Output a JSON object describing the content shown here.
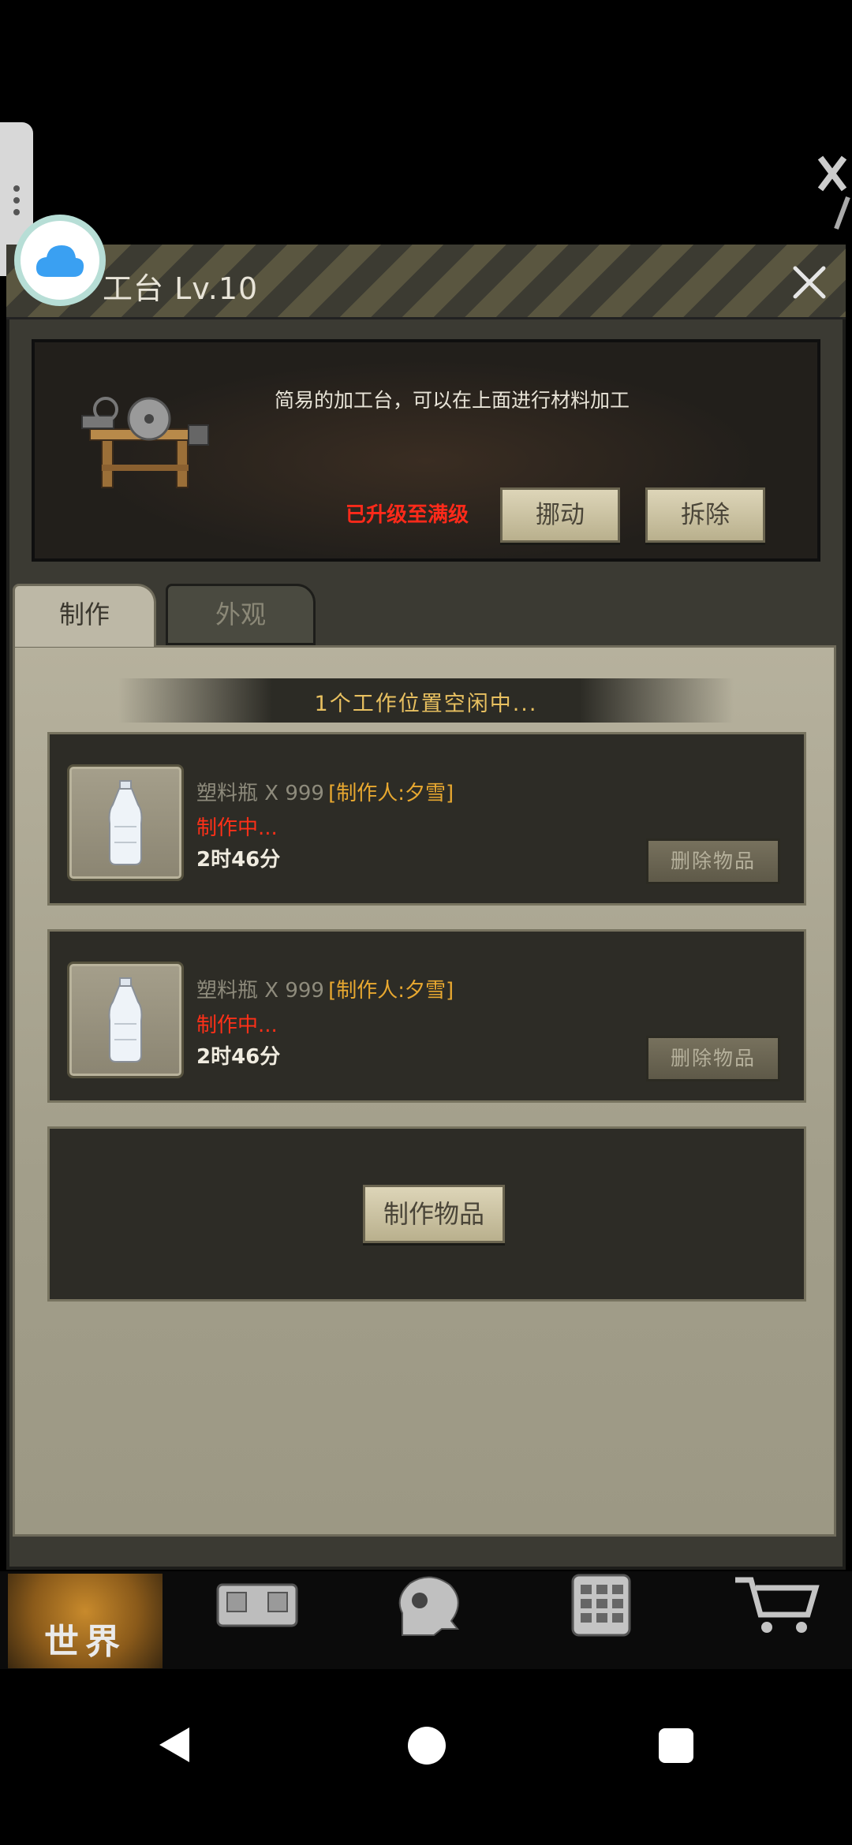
{
  "dialog": {
    "title": "工台 Lv.10",
    "description": "简易的加工台，可以在上面进行材料加工",
    "status": "已升级至满级",
    "move_label": "挪动",
    "dismantle_label": "拆除"
  },
  "tabs": [
    {
      "label": "制作",
      "active": true
    },
    {
      "label": "外观",
      "active": false
    }
  ],
  "craft": {
    "slot_status": "1个工作位置空闲中...",
    "items": [
      {
        "name": "塑料瓶 X 999",
        "maker": "[制作人:夕雪]",
        "state": "制作中...",
        "time": "2时46分",
        "delete_label": "删除物品"
      },
      {
        "name": "塑料瓶 X 999",
        "maker": "[制作人:夕雪]",
        "state": "制作中...",
        "time": "2时46分",
        "delete_label": "删除物品"
      }
    ],
    "craft_button_label": "制作物品"
  },
  "bottom_nav": {
    "world_label": "世界",
    "items": [
      "world-icon",
      "backpack-icon",
      "character-icon",
      "building-icon",
      "shop-cart-icon"
    ]
  },
  "colors": {
    "accent_gold": "#e8c060",
    "alert_red": "#ff2a1a",
    "maker_orange": "#e8a830"
  }
}
